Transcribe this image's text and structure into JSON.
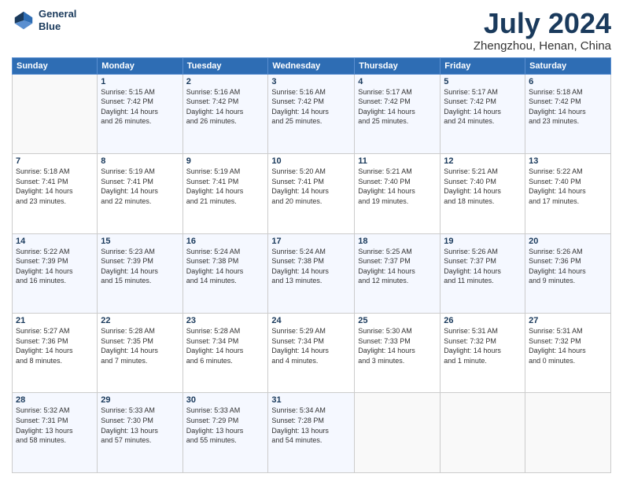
{
  "logo": {
    "line1": "General",
    "line2": "Blue"
  },
  "title": "July 2024",
  "subtitle": "Zhengzhou, Henan, China",
  "header_days": [
    "Sunday",
    "Monday",
    "Tuesday",
    "Wednesday",
    "Thursday",
    "Friday",
    "Saturday"
  ],
  "weeks": [
    [
      {
        "day": "",
        "info": ""
      },
      {
        "day": "1",
        "info": "Sunrise: 5:15 AM\nSunset: 7:42 PM\nDaylight: 14 hours\nand 26 minutes."
      },
      {
        "day": "2",
        "info": "Sunrise: 5:16 AM\nSunset: 7:42 PM\nDaylight: 14 hours\nand 26 minutes."
      },
      {
        "day": "3",
        "info": "Sunrise: 5:16 AM\nSunset: 7:42 PM\nDaylight: 14 hours\nand 25 minutes."
      },
      {
        "day": "4",
        "info": "Sunrise: 5:17 AM\nSunset: 7:42 PM\nDaylight: 14 hours\nand 25 minutes."
      },
      {
        "day": "5",
        "info": "Sunrise: 5:17 AM\nSunset: 7:42 PM\nDaylight: 14 hours\nand 24 minutes."
      },
      {
        "day": "6",
        "info": "Sunrise: 5:18 AM\nSunset: 7:42 PM\nDaylight: 14 hours\nand 23 minutes."
      }
    ],
    [
      {
        "day": "7",
        "info": "Sunrise: 5:18 AM\nSunset: 7:41 PM\nDaylight: 14 hours\nand 23 minutes."
      },
      {
        "day": "8",
        "info": "Sunrise: 5:19 AM\nSunset: 7:41 PM\nDaylight: 14 hours\nand 22 minutes."
      },
      {
        "day": "9",
        "info": "Sunrise: 5:19 AM\nSunset: 7:41 PM\nDaylight: 14 hours\nand 21 minutes."
      },
      {
        "day": "10",
        "info": "Sunrise: 5:20 AM\nSunset: 7:41 PM\nDaylight: 14 hours\nand 20 minutes."
      },
      {
        "day": "11",
        "info": "Sunrise: 5:21 AM\nSunset: 7:40 PM\nDaylight: 14 hours\nand 19 minutes."
      },
      {
        "day": "12",
        "info": "Sunrise: 5:21 AM\nSunset: 7:40 PM\nDaylight: 14 hours\nand 18 minutes."
      },
      {
        "day": "13",
        "info": "Sunrise: 5:22 AM\nSunset: 7:40 PM\nDaylight: 14 hours\nand 17 minutes."
      }
    ],
    [
      {
        "day": "14",
        "info": "Sunrise: 5:22 AM\nSunset: 7:39 PM\nDaylight: 14 hours\nand 16 minutes."
      },
      {
        "day": "15",
        "info": "Sunrise: 5:23 AM\nSunset: 7:39 PM\nDaylight: 14 hours\nand 15 minutes."
      },
      {
        "day": "16",
        "info": "Sunrise: 5:24 AM\nSunset: 7:38 PM\nDaylight: 14 hours\nand 14 minutes."
      },
      {
        "day": "17",
        "info": "Sunrise: 5:24 AM\nSunset: 7:38 PM\nDaylight: 14 hours\nand 13 minutes."
      },
      {
        "day": "18",
        "info": "Sunrise: 5:25 AM\nSunset: 7:37 PM\nDaylight: 14 hours\nand 12 minutes."
      },
      {
        "day": "19",
        "info": "Sunrise: 5:26 AM\nSunset: 7:37 PM\nDaylight: 14 hours\nand 11 minutes."
      },
      {
        "day": "20",
        "info": "Sunrise: 5:26 AM\nSunset: 7:36 PM\nDaylight: 14 hours\nand 9 minutes."
      }
    ],
    [
      {
        "day": "21",
        "info": "Sunrise: 5:27 AM\nSunset: 7:36 PM\nDaylight: 14 hours\nand 8 minutes."
      },
      {
        "day": "22",
        "info": "Sunrise: 5:28 AM\nSunset: 7:35 PM\nDaylight: 14 hours\nand 7 minutes."
      },
      {
        "day": "23",
        "info": "Sunrise: 5:28 AM\nSunset: 7:34 PM\nDaylight: 14 hours\nand 6 minutes."
      },
      {
        "day": "24",
        "info": "Sunrise: 5:29 AM\nSunset: 7:34 PM\nDaylight: 14 hours\nand 4 minutes."
      },
      {
        "day": "25",
        "info": "Sunrise: 5:30 AM\nSunset: 7:33 PM\nDaylight: 14 hours\nand 3 minutes."
      },
      {
        "day": "26",
        "info": "Sunrise: 5:31 AM\nSunset: 7:32 PM\nDaylight: 14 hours\nand 1 minute."
      },
      {
        "day": "27",
        "info": "Sunrise: 5:31 AM\nSunset: 7:32 PM\nDaylight: 14 hours\nand 0 minutes."
      }
    ],
    [
      {
        "day": "28",
        "info": "Sunrise: 5:32 AM\nSunset: 7:31 PM\nDaylight: 13 hours\nand 58 minutes."
      },
      {
        "day": "29",
        "info": "Sunrise: 5:33 AM\nSunset: 7:30 PM\nDaylight: 13 hours\nand 57 minutes."
      },
      {
        "day": "30",
        "info": "Sunrise: 5:33 AM\nSunset: 7:29 PM\nDaylight: 13 hours\nand 55 minutes."
      },
      {
        "day": "31",
        "info": "Sunrise: 5:34 AM\nSunset: 7:28 PM\nDaylight: 13 hours\nand 54 minutes."
      },
      {
        "day": "",
        "info": ""
      },
      {
        "day": "",
        "info": ""
      },
      {
        "day": "",
        "info": ""
      }
    ]
  ]
}
